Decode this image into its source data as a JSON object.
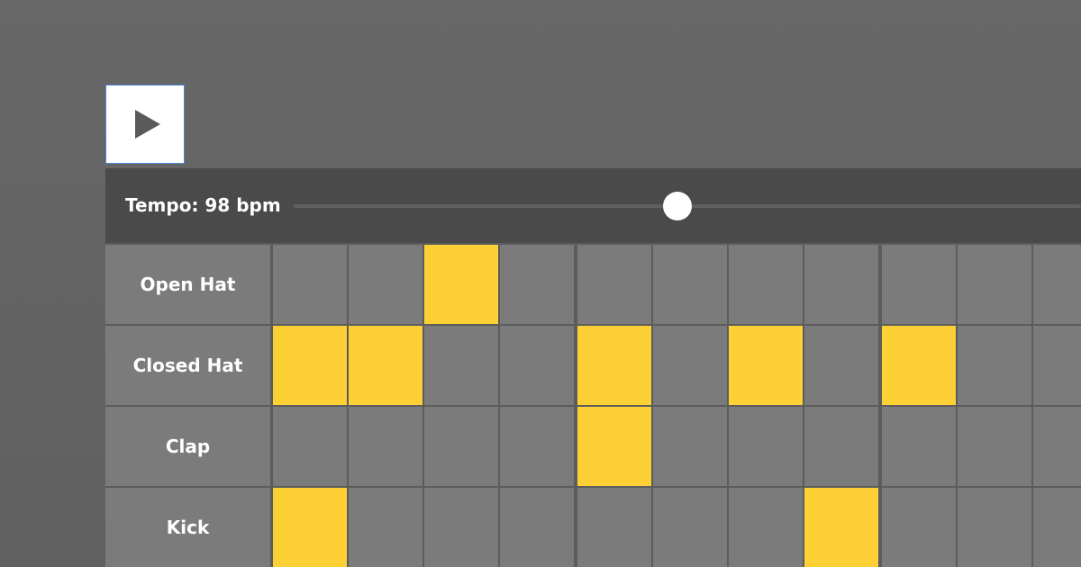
{
  "controls": {
    "play_icon": "play-icon",
    "tempo_label": "Tempo: 98 bpm",
    "tempo_bpm": 98,
    "tempo_slider_fraction": 0.487
  },
  "colors": {
    "background": "#666666",
    "tempo_bar": "#4a4a4a",
    "step_off": "#7b7b7b",
    "step_on": "#fdd135",
    "play_button_border": "#4a86d8"
  },
  "sequencer": {
    "visible_steps": 11,
    "tracks": [
      {
        "name": "Open Hat",
        "steps": [
          0,
          0,
          1,
          0,
          0,
          0,
          0,
          0,
          0,
          0,
          0
        ]
      },
      {
        "name": "Closed Hat",
        "steps": [
          1,
          1,
          0,
          0,
          1,
          0,
          1,
          0,
          1,
          0,
          0
        ]
      },
      {
        "name": "Clap",
        "steps": [
          0,
          0,
          0,
          0,
          1,
          0,
          0,
          0,
          0,
          0,
          0
        ]
      },
      {
        "name": "Kick",
        "steps": [
          1,
          0,
          0,
          0,
          0,
          0,
          0,
          1,
          0,
          0,
          0
        ]
      }
    ]
  }
}
